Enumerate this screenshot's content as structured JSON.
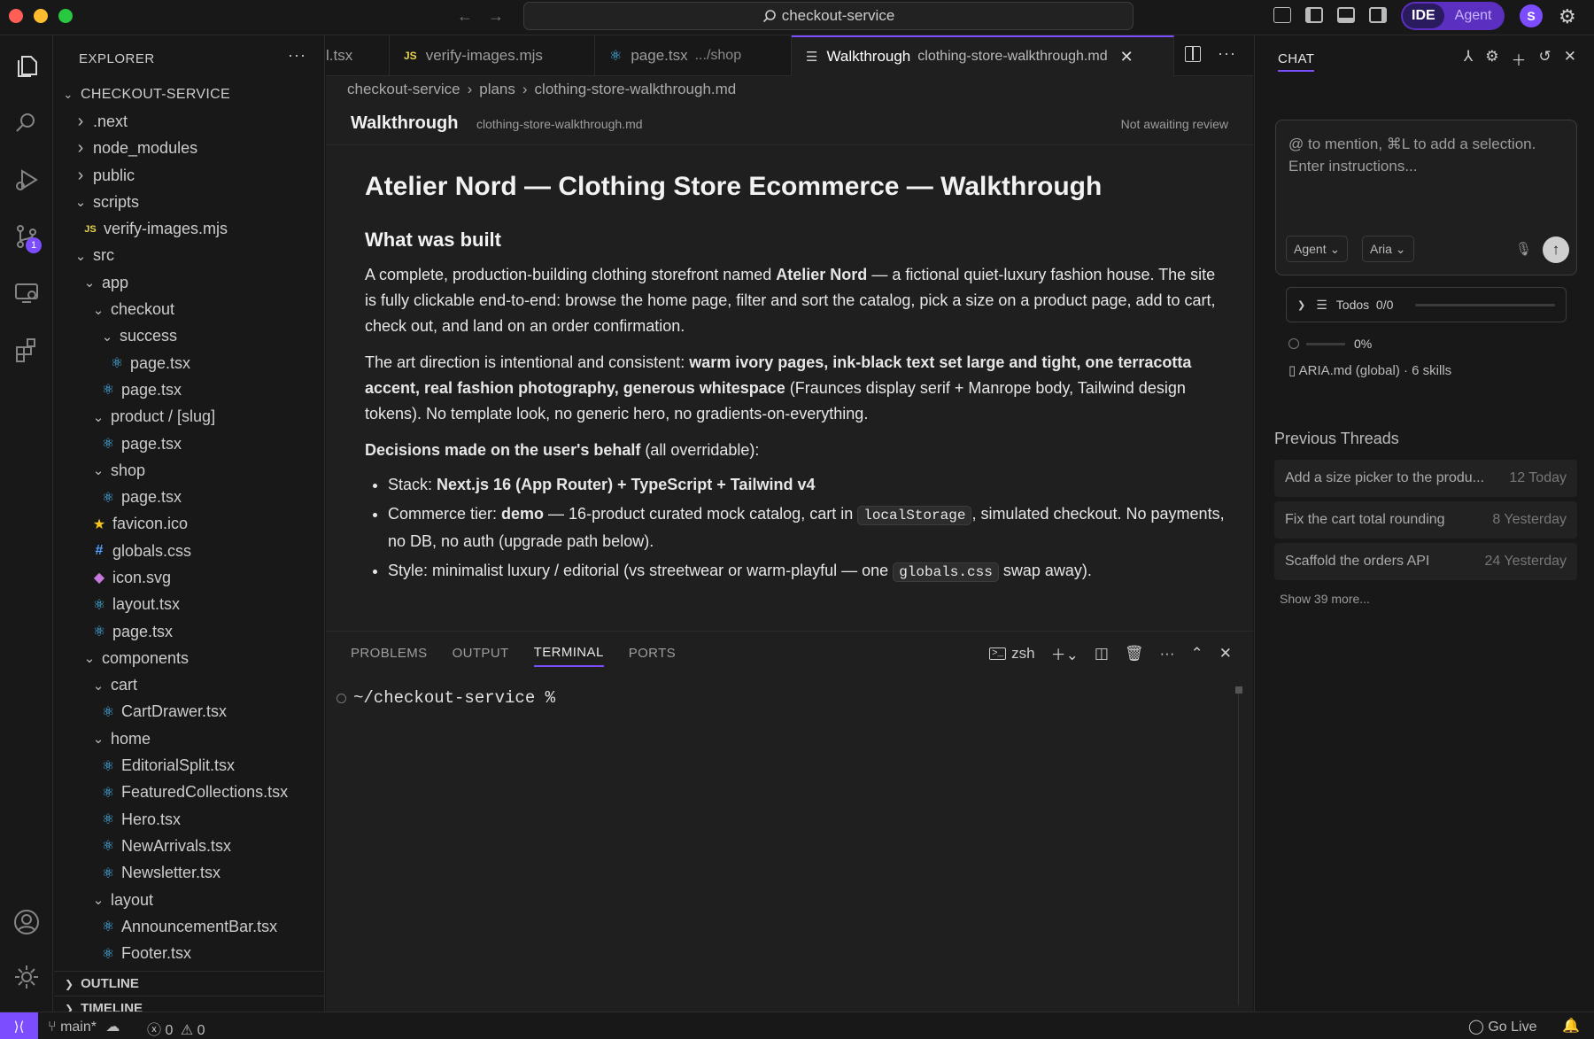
{
  "window": {
    "command_center": "checkout-service",
    "mode_ide": "IDE",
    "mode_agent": "Agent",
    "avatar_initial": "S"
  },
  "activity_bar": {
    "scm_badge": "1"
  },
  "explorer": {
    "title": "EXPLORER",
    "more": "···",
    "root": "CHECKOUT-SERVICE",
    "tree": [
      {
        "label": ".next",
        "depth": 1,
        "kind": "folder",
        "open": false
      },
      {
        "label": "node_modules",
        "depth": 1,
        "kind": "folder",
        "open": false
      },
      {
        "label": "public",
        "depth": 1,
        "kind": "folder",
        "open": false
      },
      {
        "label": "scripts",
        "depth": 1,
        "kind": "folder",
        "open": true
      },
      {
        "label": "verify-images.mjs",
        "depth": 2,
        "kind": "js"
      },
      {
        "label": "src",
        "depth": 1,
        "kind": "folder",
        "open": true
      },
      {
        "label": "app",
        "depth": 2,
        "kind": "folder",
        "open": true
      },
      {
        "label": "checkout",
        "depth": 3,
        "kind": "folder",
        "open": true
      },
      {
        "label": "success",
        "depth": 4,
        "kind": "folder",
        "open": true
      },
      {
        "label": "page.tsx",
        "depth": 5,
        "kind": "react"
      },
      {
        "label": "page.tsx",
        "depth": 4,
        "kind": "react"
      },
      {
        "label": "product / [slug]",
        "depth": 3,
        "kind": "folder",
        "open": true
      },
      {
        "label": "page.tsx",
        "depth": 4,
        "kind": "react"
      },
      {
        "label": "shop",
        "depth": 3,
        "kind": "folder",
        "open": true
      },
      {
        "label": "page.tsx",
        "depth": 4,
        "kind": "react"
      },
      {
        "label": "favicon.ico",
        "depth": 3,
        "kind": "star"
      },
      {
        "label": "globals.css",
        "depth": 3,
        "kind": "css"
      },
      {
        "label": "icon.svg",
        "depth": 3,
        "kind": "svg"
      },
      {
        "label": "layout.tsx",
        "depth": 3,
        "kind": "react"
      },
      {
        "label": "page.tsx",
        "depth": 3,
        "kind": "react"
      },
      {
        "label": "components",
        "depth": 2,
        "kind": "folder",
        "open": true
      },
      {
        "label": "cart",
        "depth": 3,
        "kind": "folder",
        "open": true
      },
      {
        "label": "CartDrawer.tsx",
        "depth": 4,
        "kind": "react"
      },
      {
        "label": "home",
        "depth": 3,
        "kind": "folder",
        "open": true
      },
      {
        "label": "EditorialSplit.tsx",
        "depth": 4,
        "kind": "react"
      },
      {
        "label": "FeaturedCollections.tsx",
        "depth": 4,
        "kind": "react"
      },
      {
        "label": "Hero.tsx",
        "depth": 4,
        "kind": "react"
      },
      {
        "label": "NewArrivals.tsx",
        "depth": 4,
        "kind": "react"
      },
      {
        "label": "Newsletter.tsx",
        "depth": 4,
        "kind": "react"
      },
      {
        "label": "layout",
        "depth": 3,
        "kind": "folder",
        "open": true
      },
      {
        "label": "AnnouncementBar.tsx",
        "depth": 4,
        "kind": "react"
      },
      {
        "label": "Footer.tsx",
        "depth": 4,
        "kind": "react"
      }
    ],
    "outline": "OUTLINE",
    "timeline": "TIMELINE"
  },
  "tabs": [
    {
      "label": "l.tsx",
      "desc": "",
      "icon": ""
    },
    {
      "label": "verify-images.mjs",
      "desc": "",
      "icon": "JS"
    },
    {
      "label": "page.tsx",
      "desc": ".../shop",
      "icon": "react"
    },
    {
      "label": "Walkthrough",
      "desc": "clothing-store-walkthrough.md",
      "icon": "list",
      "active": true
    }
  ],
  "breadcrumb": [
    "checkout-service",
    "plans",
    "clothing-store-walkthrough.md"
  ],
  "md_header": {
    "title": "Walkthrough",
    "file": "clothing-store-walkthrough.md",
    "status": "Not awaiting review"
  },
  "doc": {
    "h1": "Atelier Nord — Clothing Store Ecommerce — Walkthrough",
    "h2": "What was built",
    "p1_a": "A complete, production-building clothing storefront named ",
    "p1_b": "Atelier Nord",
    "p1_c": " — a fictional quiet-luxury fashion house. The site is fully clickable end-to-end: browse the home page, filter and sort the catalog, pick a size on a product page, add to cart, check out, and land on an order confirmation.",
    "p2_a": "The art direction is intentional and consistent: ",
    "p2_b": "warm ivory pages, ink-black text set large and tight, one terracotta accent, real fashion photography, generous whitespace",
    "p2_c": " (Fraunces display serif + Manrope body, Tailwind design tokens). No template look, no generic hero, no gradients-on-everything.",
    "p3_a": "Decisions made on the user's behalf",
    "p3_b": " (all overridable):",
    "li1_a": "Stack: ",
    "li1_b": "Next.js 16 (App Router) + TypeScript + Tailwind v4",
    "li2_a": "Commerce tier: ",
    "li2_b": "demo",
    "li2_c": " — 16-product curated mock catalog, cart in ",
    "li2_code": "localStorage",
    "li2_d": ", simulated checkout. No payments, no DB, no auth (upgrade path below).",
    "li3_a": "Style: minimalist luxury / editorial (vs streetwear or warm-playful — one ",
    "li3_code": "globals.css",
    "li3_b": " swap away)."
  },
  "panel": {
    "tabs": [
      "PROBLEMS",
      "OUTPUT",
      "TERMINAL",
      "PORTS"
    ],
    "active_tab": "TERMINAL",
    "shell": "zsh",
    "prompt": "~/checkout-service %"
  },
  "chat": {
    "title": "CHAT",
    "placeholder": "@ to mention, ⌘L to add a selection. Enter instructions...",
    "mode_select": "Agent",
    "model_select": "Aria",
    "todos_label": "Todos",
    "todos_count": "0/0",
    "progress": "0%",
    "skills": "ARIA.md (global) · 6 skills",
    "previous_title": "Previous Threads",
    "threads": [
      {
        "title": "Add a size picker to the produ...",
        "meta": "12 Today"
      },
      {
        "title": "Fix the cart total rounding",
        "meta": "8 Yesterday"
      },
      {
        "title": "Scaffold the orders API",
        "meta": "24 Yesterday"
      }
    ],
    "show_more": "Show 39 more..."
  },
  "status": {
    "branch": "main*",
    "errors": "0",
    "warnings": "0",
    "golive": "Go Live"
  },
  "colors": {
    "accent": "#7c4dff",
    "bg": "#181818",
    "editor_bg": "#1f1f1f"
  }
}
